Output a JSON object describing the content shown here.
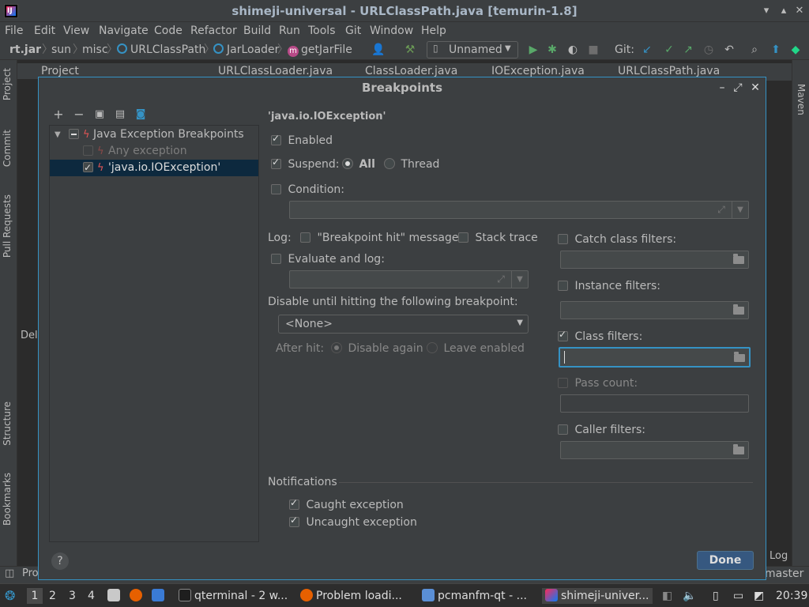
{
  "window": {
    "title": "shimeji-universal - URLClassPath.java [temurin-1.8]"
  },
  "menu": [
    "File",
    "Edit",
    "View",
    "Navigate",
    "Code",
    "Refactor",
    "Build",
    "Run",
    "Tools",
    "Git",
    "Window",
    "Help"
  ],
  "navbar": {
    "crumbs": [
      "rt.jar",
      "sun",
      "misc",
      "URLClassPath",
      "JarLoader",
      "getJarFile"
    ],
    "run_config": "Unnamed",
    "git_label": "Git:"
  },
  "bg_tabs": [
    "Project",
    "URLClassLoader.java",
    "ClassLoader.java",
    "IOException.java",
    "URLClassPath.java"
  ],
  "left_strip": [
    "Project",
    "Commit",
    "Pull Requests",
    "Structure",
    "Bookmarks"
  ],
  "right_strip": [
    "Maven"
  ],
  "bg_misc": {
    "debug_tab": "Del",
    "log_label": "Log",
    "branch": "master",
    "problems": "Pro"
  },
  "dialog": {
    "title": "Breakpoints",
    "tree": {
      "group_label": "Java Exception Breakpoints",
      "items": [
        {
          "label": "Any exception",
          "checked": false,
          "enabled": false
        },
        {
          "label": "'java.io.IOException'",
          "checked": true,
          "enabled": true
        }
      ]
    },
    "detail": {
      "heading": "'java.io.IOException'",
      "enabled_label": "Enabled",
      "suspend_label": "Suspend:",
      "suspend_all": "All",
      "suspend_thread": "Thread",
      "condition_label": "Condition:",
      "condition_value": "",
      "log_label": "Log:",
      "log_message": "\"Breakpoint hit\" message",
      "log_stack": "Stack trace",
      "evaluate_label": "Evaluate and log:",
      "disable_until_label": "Disable until hitting the following breakpoint:",
      "disable_until_value": "<None>",
      "after_hit_label": "After hit:",
      "after_hit_disable": "Disable again",
      "after_hit_leave": "Leave enabled",
      "catch_filters": "Catch class filters:",
      "instance_filters": "Instance filters:",
      "class_filters": "Class filters:",
      "pass_count": "Pass count:",
      "caller_filters": "Caller filters:",
      "notifications_label": "Notifications",
      "caught_exception": "Caught exception",
      "uncaught_exception": "Uncaught exception"
    },
    "done_label": "Done",
    "help_label": "?"
  },
  "taskbar": {
    "workspaces": [
      "1",
      "2",
      "3",
      "4"
    ],
    "tasks": [
      "qterminal - 2 w...",
      "Problem loadi...",
      "pcmanfm-qt - ...",
      "shimeji-univer..."
    ],
    "clock": "20:39"
  }
}
